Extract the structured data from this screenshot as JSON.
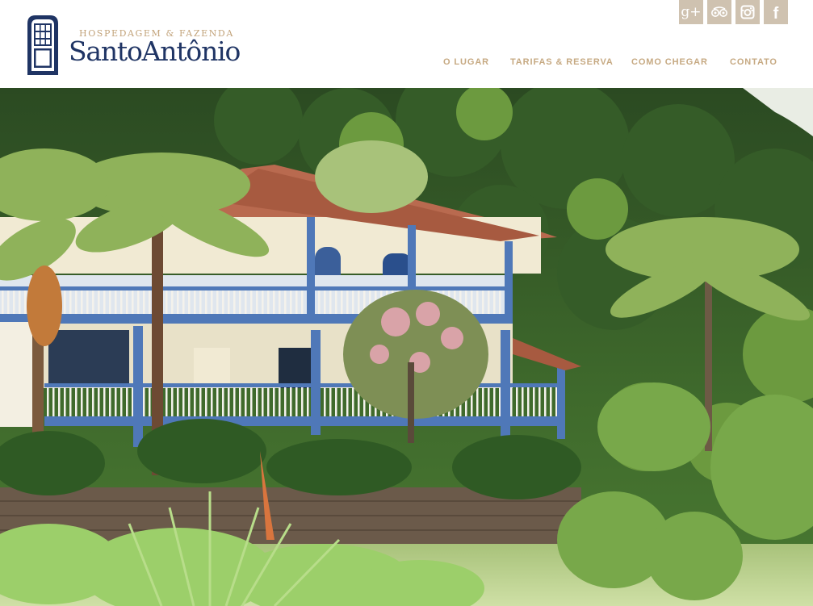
{
  "header": {
    "tagline": "HOSPEDAGEM & FAZENDA",
    "brand_name": "SantoAntônio",
    "logo_icon": "window-door-icon"
  },
  "social": [
    {
      "name": "google-plus-icon",
      "glyph": "g+"
    },
    {
      "name": "tripadvisor-icon"
    },
    {
      "name": "instagram-icon"
    },
    {
      "name": "facebook-icon",
      "glyph": "f"
    }
  ],
  "nav": {
    "items": [
      {
        "label": "O LUGAR"
      },
      {
        "label": "TARIFAS & RESERVA"
      },
      {
        "label": "COMO CHEGAR"
      },
      {
        "label": "CONTATO"
      }
    ]
  },
  "colors": {
    "brand": "#1f3464",
    "accent": "#c6a982",
    "social_bg": "#cfc2b0",
    "house_wall": "#f1ead3",
    "house_trim": "#4f78b8",
    "roof": "#b96a4f"
  }
}
